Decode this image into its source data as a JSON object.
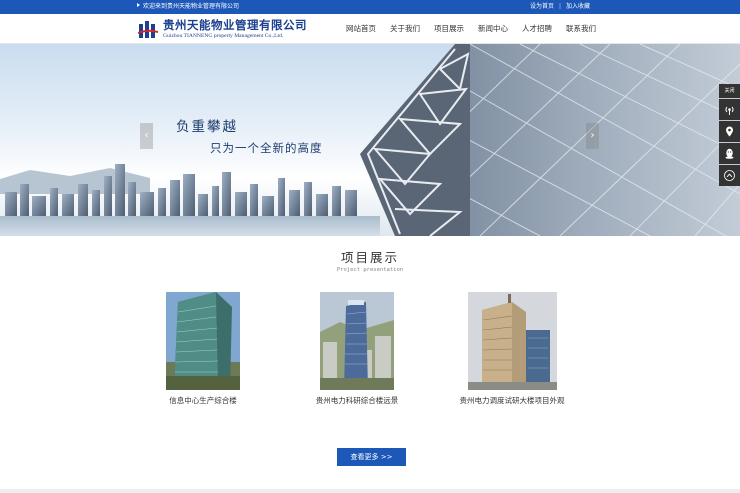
{
  "topbar": {
    "welcome": "欢迎来到贵州天能物业管理有限公司",
    "set_home": "设为首页",
    "add_favorite": "加入收藏"
  },
  "logo": {
    "name_cn": "贵州天能物业管理有限公司",
    "name_en": "Guizhou TIANNENG property Management Co.,Ltd."
  },
  "nav": {
    "items": [
      "网站首页",
      "关于我们",
      "项目展示",
      "新闻中心",
      "人才招聘",
      "联系我们"
    ]
  },
  "banner": {
    "slogan_line1": "负重攀越",
    "slogan_line2": "只为一个全新的高度",
    "prev_icon": "chevron-left-icon",
    "next_icon": "chevron-right-icon"
  },
  "float_bar": {
    "close_label": "关闭",
    "icons": [
      "broadcast-icon",
      "location-pin-icon",
      "qq-icon",
      "back-to-top-icon"
    ]
  },
  "projects": {
    "title": "项目展示",
    "subtitle": "Project presentation",
    "items": [
      {
        "caption": "信息中心生产综合楼"
      },
      {
        "caption": "贵州电力科研综合楼远景"
      },
      {
        "caption": "贵州电力调度试研大楼项目外观"
      }
    ],
    "more_label": "查看更多 >>"
  },
  "colors": {
    "brand_blue": "#1d58b8",
    "float_bar_bg": "#333333"
  }
}
